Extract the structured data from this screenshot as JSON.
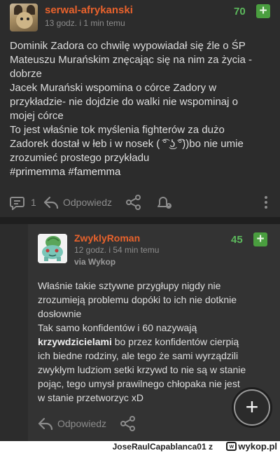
{
  "post": {
    "author": "serwal-afrykanski",
    "time": "13 godz. i 1 min temu",
    "votes": "70",
    "plus_label": "+",
    "lines": [
      "Dominik Zadora co chwilę wypowiadał się źle o ŚP",
      "Mateuszu Murańskim znęcając się na nim za życia -",
      "dobrze",
      "Jacek Murański wspomina o córce Zadory w",
      "przykładzie- nie dojdzie do walki nie wspominaj o",
      "mojej córce",
      "To jest właśnie tok myślenia fighterów za dużo",
      "Zadorek dostał w łeb i w nosek ( ͡° ͜ʖ ͡°))bo nie umie",
      "zrozumieć prostego przykładu"
    ],
    "tags": "#primemma #famemma",
    "comment_count": "1",
    "reply_label": "Odpowiedz"
  },
  "reply": {
    "author": "ZwyklyRoman",
    "time": "12 godz. i 54 min temu",
    "via": "via Wykop",
    "votes": "45",
    "plus_label": "+",
    "paragraph1": [
      "Właśnie takie sztywne przygłupy nigdy nie",
      "zrozumieją problemu dopóki to ich nie dotknie",
      "dosłownie"
    ],
    "p2_line1": "Tak samo konfidentów i 60 nazywają",
    "p2_bold": "krzywdzicielami",
    "p2_rest": " bo przez konfidentów cierpią",
    "paragraph2_tail": [
      "ich biedne rodziny, ale tego że sami wyrządzili",
      "zwykłym ludziom setki krzywd to nie są w stanie",
      "pojąc, tego umysł prawilnego chłopaka nie jest",
      "w stanie przetworzyc xD"
    ],
    "reply_label": "Odpowiedz"
  },
  "fab": {
    "label": "+"
  },
  "watermark": {
    "user": "JoseRaulCapablanca01 z",
    "brand": "wykop.pl",
    "logo_glyph": "w"
  },
  "icons": {
    "comments": "comments-icon",
    "reply": "reply-arrow-icon",
    "share": "share-icon",
    "alert": "report-icon",
    "more": "more-vertical-icon"
  },
  "colors": {
    "author": "#e8622c",
    "votes": "#5cb85c",
    "plus_bg": "#4a9e3f",
    "background": "#2c2c2c",
    "reply_background": "#333333"
  }
}
